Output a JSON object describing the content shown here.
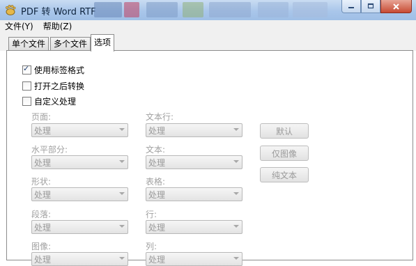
{
  "window": {
    "title": "PDF 转 Word RTF",
    "app_icon": "gnome-foot-icon"
  },
  "window_controls": {
    "minimize": "minimize-icon",
    "maximize": "maximize-icon",
    "close": "close-icon"
  },
  "menu": {
    "items": [
      "文件(Y)",
      "帮助(Z)"
    ]
  },
  "tabs": [
    {
      "label": "单个文件",
      "active": false
    },
    {
      "label": "多个文件",
      "active": false
    },
    {
      "label": "选项",
      "active": true
    }
  ],
  "options": {
    "use_tag_format": {
      "label": "使用标签格式",
      "checked": true
    },
    "convert_after_open": {
      "label": "打开之后转换",
      "checked": false
    },
    "custom_processing": {
      "label": "自定义处理",
      "checked": false
    }
  },
  "fields_left": [
    {
      "label": "页面:",
      "value": "处理"
    },
    {
      "label": "水平部分:",
      "value": "处理"
    },
    {
      "label": "形状:",
      "value": "处理"
    },
    {
      "label": "段落:",
      "value": "处理"
    },
    {
      "label": "图像:",
      "value": "处理"
    }
  ],
  "fields_right": [
    {
      "label": "文本行:",
      "value": "处理"
    },
    {
      "label": "文本:",
      "value": "处理"
    },
    {
      "label": "表格:",
      "value": "处理"
    },
    {
      "label": "行:",
      "value": "处理"
    },
    {
      "label": "列:",
      "value": "处理"
    }
  ],
  "buttons": {
    "default": "默认",
    "image_only": "仅图像",
    "text_only": "纯文本"
  },
  "colors": {
    "titlebar": "#a9c6ea",
    "close_button": "#c74a33",
    "disabled_text": "#a0a0a0"
  }
}
